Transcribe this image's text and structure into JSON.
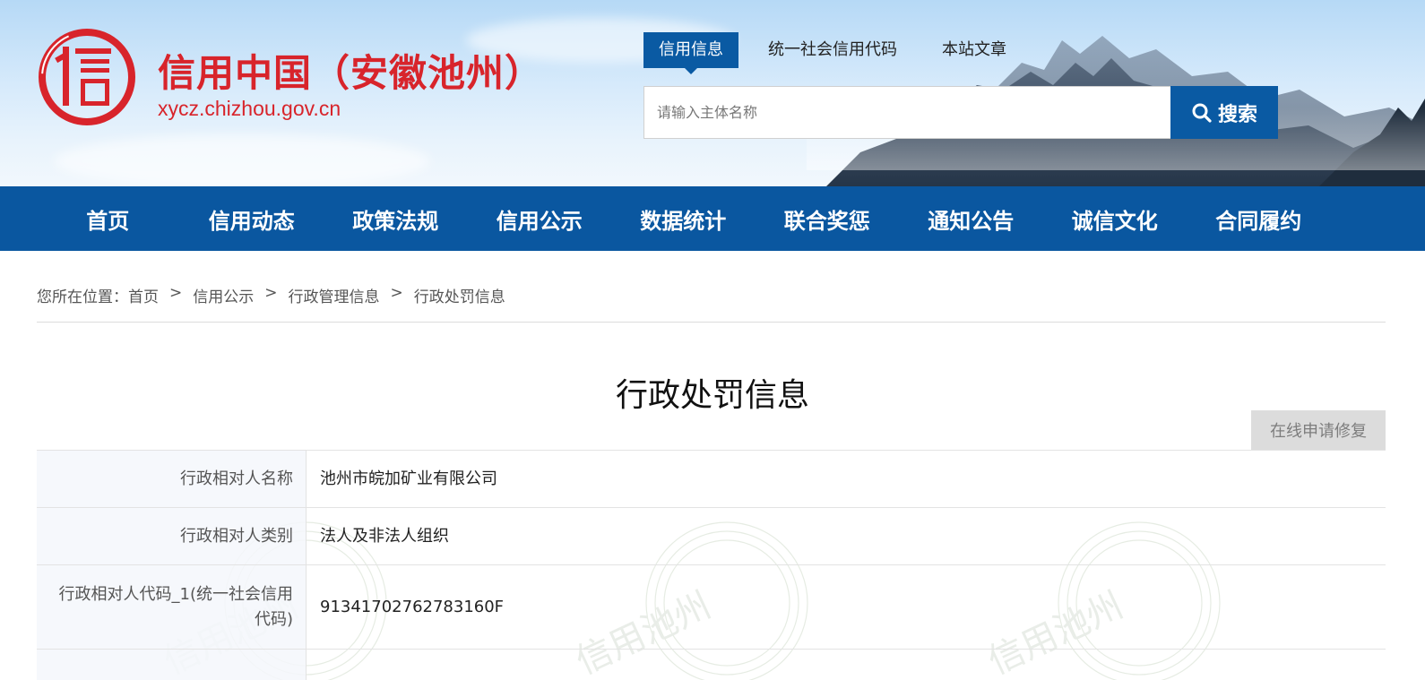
{
  "site": {
    "title": "信用中国（安徽池州）",
    "url": "xycz.chizhou.gov.cn",
    "logo_icon": "xin-seal-logo",
    "logo_text": "信",
    "brand_color": "#d8242b"
  },
  "search": {
    "tabs": [
      {
        "label": "信用信息",
        "active": true
      },
      {
        "label": "统一社会信用代码",
        "active": false
      },
      {
        "label": "本站文章",
        "active": false
      }
    ],
    "placeholder": "请输入主体名称",
    "button_label": "搜索",
    "button_icon": "search-icon"
  },
  "nav": {
    "color": "#0a57a0",
    "items": [
      "首页",
      "信用动态",
      "政策法规",
      "信用公示",
      "数据统计",
      "联合奖惩",
      "通知公告",
      "诚信文化",
      "合同履约"
    ]
  },
  "breadcrumb": {
    "prefix": "您所在位置：",
    "items": [
      "首页",
      "信用公示",
      "行政管理信息",
      "行政处罚信息"
    ],
    "separator": ">"
  },
  "page": {
    "title": "行政处罚信息",
    "repair_button": "在线申请修复"
  },
  "info": {
    "rows": [
      {
        "label": "行政相对人名称",
        "value": "池州市皖加矿业有限公司"
      },
      {
        "label": "行政相对人类别",
        "value": "法人及非法人组织"
      },
      {
        "label": "行政相对人代码_1(统一社会信用代码)",
        "value": "91341702762783160F"
      },
      {
        "label": "",
        "value": ""
      }
    ],
    "watermark": "信用池州"
  }
}
